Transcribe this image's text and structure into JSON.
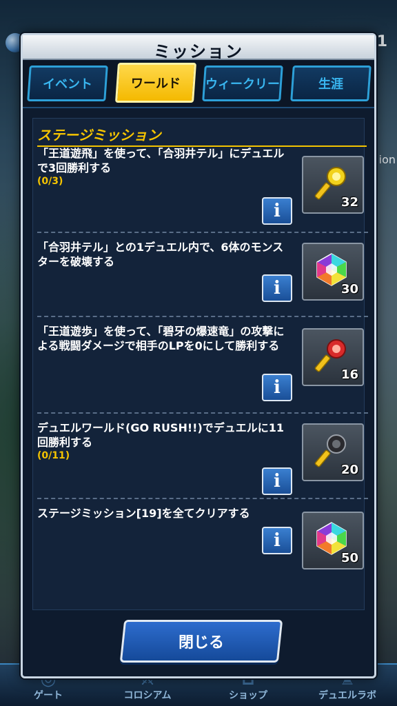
{
  "background": {
    "right_text": "ion",
    "right_number": "1"
  },
  "bottom_nav": [
    {
      "label": "ゲート",
      "icon": "gate-icon"
    },
    {
      "label": "コロシアム",
      "icon": "colosseum-icon"
    },
    {
      "label": "ショップ",
      "icon": "shop-icon"
    },
    {
      "label": "デュエルラボ",
      "icon": "duel-lab-icon"
    }
  ],
  "modal": {
    "title": "ミッション",
    "tabs": [
      {
        "label": "イベント",
        "active": false
      },
      {
        "label": "ワールド",
        "active": true
      },
      {
        "label": "ウィークリー",
        "active": false
      },
      {
        "label": "生涯",
        "active": false
      }
    ],
    "section_title": "ステージミッション",
    "missions": [
      {
        "text": "「王道遊飛」を使って、「合羽井テル」にデュエルで3回勝利する",
        "progress": "(0/3)",
        "reward_icon": "gold-key-icon",
        "reward_count": "32"
      },
      {
        "text": "「合羽井テル」との1デュエル内で、6体のモンスターを破壊する",
        "progress": "",
        "reward_icon": "rainbow-gem-icon",
        "reward_count": "30"
      },
      {
        "text": "「王道遊歩」を使って、「碧牙の爆速竜」の攻撃による戦闘ダメージで相手のLPを0にして勝利する",
        "progress": "",
        "reward_icon": "red-key-icon",
        "reward_count": "16"
      },
      {
        "text": "デュエルワールド(GO RUSH!!)でデュエルに11回勝利する",
        "progress": "(0/11)",
        "reward_icon": "black-key-icon",
        "reward_count": "20"
      },
      {
        "text": "ステージミッション[19]を全てクリアする",
        "progress": "",
        "reward_icon": "rainbow-gem-icon",
        "reward_count": "50"
      }
    ],
    "info_label": "i",
    "close_label": "閉じる"
  },
  "colors": {
    "accent_yellow": "#f5c400",
    "tab_blue": "#39b6f0",
    "button_blue": "#1a4f98"
  }
}
